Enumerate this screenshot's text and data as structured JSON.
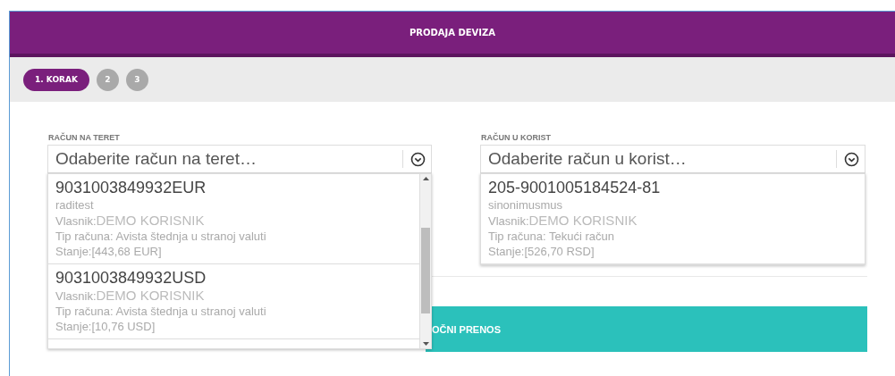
{
  "header": {
    "title": "PRODAJA DEVIZA"
  },
  "steps": [
    {
      "label": "1. KORAK",
      "selected": true
    },
    {
      "label": "2",
      "selected": false
    },
    {
      "label": "3",
      "selected": false
    }
  ],
  "fields": [
    {
      "label": "RAČUN NA TERET",
      "placeholder": "Odaberite račun na teret…",
      "expanded": true,
      "options": [
        {
          "number": "9031003849932EUR",
          "name": "raditest",
          "owner_label": "Vlasnik:",
          "owner": "DEMO KORISNIK",
          "type": "Tip računa: Avista štednja u stranoj valuti",
          "balance": "Stanje:[443,68 EUR]"
        },
        {
          "number": "9031003849932USD",
          "owner_label": "Vlasnik:",
          "owner": "DEMO KORISNIK",
          "type": "Tip računa: Avista štednja u stranoj valuti",
          "balance": "Stanje:[10,76 USD]"
        }
      ]
    },
    {
      "label": "RAČUN U KORIST",
      "placeholder": "Odaberite račun u korist…",
      "expanded": true,
      "options": [
        {
          "number": "205-9001005184524-81",
          "name": "sinonimusmus",
          "owner_label": "Vlasnik:",
          "owner": "DEMO KORISNIK",
          "type": "Tip računa: Tekući račun",
          "balance": "Stanje:[526,70 RSD]"
        }
      ]
    }
  ],
  "button": {
    "label": "OČNI PRENOS"
  }
}
